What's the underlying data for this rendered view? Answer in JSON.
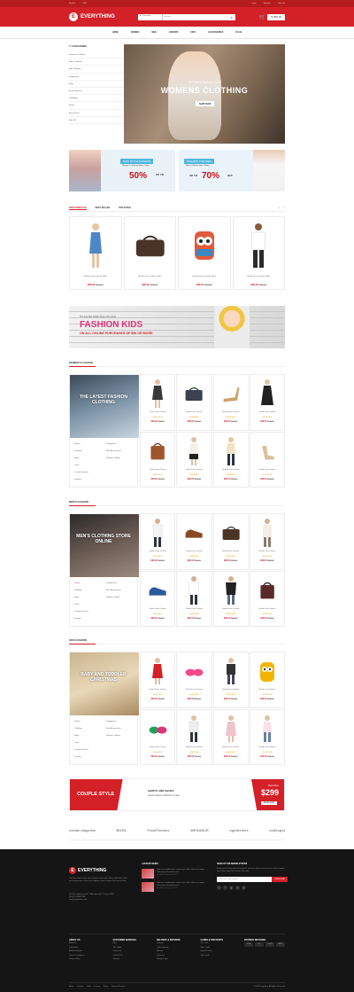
{
  "topbar": {
    "left": [
      "English",
      "USD"
    ],
    "right": [
      "Login",
      "Register",
      "Wish list"
    ]
  },
  "header": {
    "logo_text": "EVERYTHING",
    "logo_mark": "E",
    "search_category": "All Categories",
    "search_placeholder": "Search",
    "cart_total": "$ 250.00"
  },
  "nav": [
    "HOME",
    "WOMEN",
    "MEN",
    "JUNIORS",
    "KIDS",
    "ACCESSORIES",
    "BLOG"
  ],
  "sidebar": {
    "title": "CATEGORIES",
    "items": [
      "Women's Clothing",
      "Men's Clothing",
      "Kids Clothing",
      "Sunglasses",
      "Bags",
      "Smart Watches",
      "Handbags",
      "Shoes",
      "Accessories",
      "Sale Off"
    ]
  },
  "hero": {
    "subtitle": "The latest fashion trend",
    "title": "WOMENS CLOTHING",
    "cta": "SHOP NOW"
  },
  "promo_left": {
    "tag": "NEW STYLE FASHION",
    "line": "Women's Clothing Starts Online",
    "pct": "50%",
    "upto": "UP TO"
  },
  "promo_right": {
    "tag": "FASHION FOR MEN",
    "line": "Men's Clothing Sale Online",
    "pct": "70%",
    "upto": "UP TO",
    "off": "OFF"
  },
  "tabs": [
    "NEW PRODUCTS",
    "BEST SELLER",
    "TOP RATED"
  ],
  "products": [
    {
      "name": "Grand Lucas Canvas Oben",
      "price": "$28.00",
      "old": "$58.00"
    },
    {
      "name": "Grand Lucas Canvas Oben",
      "price": "$28.00",
      "old": "$58.00"
    },
    {
      "name": "Grand Lucas Canvas Oben",
      "price": "$28.00",
      "old": "$58.00"
    },
    {
      "name": "Grand Lucas Canvas Oben",
      "price": "$28.00",
      "old": "$58.00"
    }
  ],
  "kids_banner": {
    "line1": "The best kids fashion blog of the world",
    "title": "FASHION KIDS",
    "line3": "ON ALL ONLINE PURCHASES OF $50 OR MORE"
  },
  "sections": [
    {
      "title": "WOMEN'S FASHION",
      "overlay": "THE LATEST FASHION CLOTHING",
      "sub": "",
      "links": [
        "Shoes",
        "Sunglasses",
        "Clothing",
        "Men Accessories",
        "Bags",
        "Women's Boots",
        "Coat",
        "",
        "Casual Dresses",
        "",
        "Lipstick",
        ""
      ]
    },
    {
      "title": "MEN'S FASHION",
      "overlay": "MEN'S CLOTHING STORE ONLINE",
      "sub": "",
      "links": [
        "Shoes",
        "Sunglasses",
        "Clothing",
        "Men Accessories",
        "Bags",
        "Women's Boots",
        "Coat",
        "",
        "Casual Dresses",
        "",
        "Lipstick",
        ""
      ]
    },
    {
      "title": "KIDS FASHION",
      "overlay": "BABY AND TODDLER CHRISTMAS",
      "sub": "",
      "links": [
        "Shoes",
        "Sunglasses",
        "Clothing",
        "Men Accessories",
        "Bags",
        "Women's Boots",
        "Coat",
        "",
        "Casual Dresses",
        "",
        "Lipstick",
        ""
      ]
    }
  ],
  "grid_item": {
    "name": "Grand Lucas Canvas",
    "stars": "★★★★★",
    "price": "$28.00",
    "old": "$58.00"
  },
  "couple": {
    "title": "COUPLE STYLE",
    "m1": "SHIRTS AND SHOES",
    "m2": "Fashion Shoes Collection for Men",
    "best": "Best Price",
    "price": "$299",
    "shop": "SHOP NOW"
  },
  "brands": [
    "ornate magenta",
    "BOSS",
    "FrostThemes",
    "WPDANCE",
    "egothemes",
    "codespot"
  ],
  "footer": {
    "logo": "EVERYTHING",
    "about": "Curabitur lobortis porta porta in ipsum malesuada. Mauris bibendum, nulla accumsan pretium lorem eros vulputate, ipsum tempor felis urna ut dolor.",
    "contact": "204 Fairs laborum street, Tidbit city name, Country 30009\n(208) 555 8989 7890\ninfo@yourdomain.com",
    "news_title": "LASTEST NEWS",
    "news": [
      {
        "text": "Duis risus condimentum consectetur ullam. Etiam est magna, ullamcorper fermentum sem...",
        "date": "by admin   January 01, 2017"
      },
      {
        "text": "Duis risus condimentum consectetur ullam. Etiam est magna, ullamcorper fermentum sem...",
        "date": "by admin   January 01, 2017"
      }
    ],
    "nl_title": "SIGN UP FOR NEWSLETTERS",
    "nl_desc": "Be the first to know about new arrivals, exclusive offers and much more. Plus, first-time subscribers enjoy 10% off their first order.",
    "nl_placeholder": "Enter your email address",
    "nl_btn": "SUBSCRIBE",
    "social": [
      "f",
      "t",
      "g",
      "p",
      "in"
    ],
    "cols": [
      {
        "title": "ABOUT US",
        "items": [
          "About Us",
          "Promotions",
          "Affiliate Program",
          "Terms & Conditions",
          "Privacy Policy"
        ]
      },
      {
        "title": "CUSTOMER SERVICES",
        "items": [
          "FAQ",
          "Size Guide",
          "Contact Us",
          "Sell With Us",
          "Sitemap"
        ]
      },
      {
        "title": "DELIVERY & RETURNS",
        "items": [
          "Delivery",
          "Order Tracking",
          "Returns",
          "E-Receipt",
          "Buying Guides"
        ]
      },
      {
        "title": "CARDS & DISCOUNTS",
        "items": [
          "Gift Cards",
          "Store Cards",
          "Buy Gift Cards",
          "Sale Cards"
        ]
      },
      {
        "title": "PAYMENT METHODS",
        "items": []
      }
    ],
    "pay": [
      "VISA",
      "MC",
      "PayPal",
      "AMEX"
    ],
    "bottom_links": [
      "About",
      "Contact",
      "Help",
      "Privacy",
      "Policy",
      "Terms of Service"
    ],
    "copyright": "© 2016 Everything. All Rights Reserved."
  }
}
